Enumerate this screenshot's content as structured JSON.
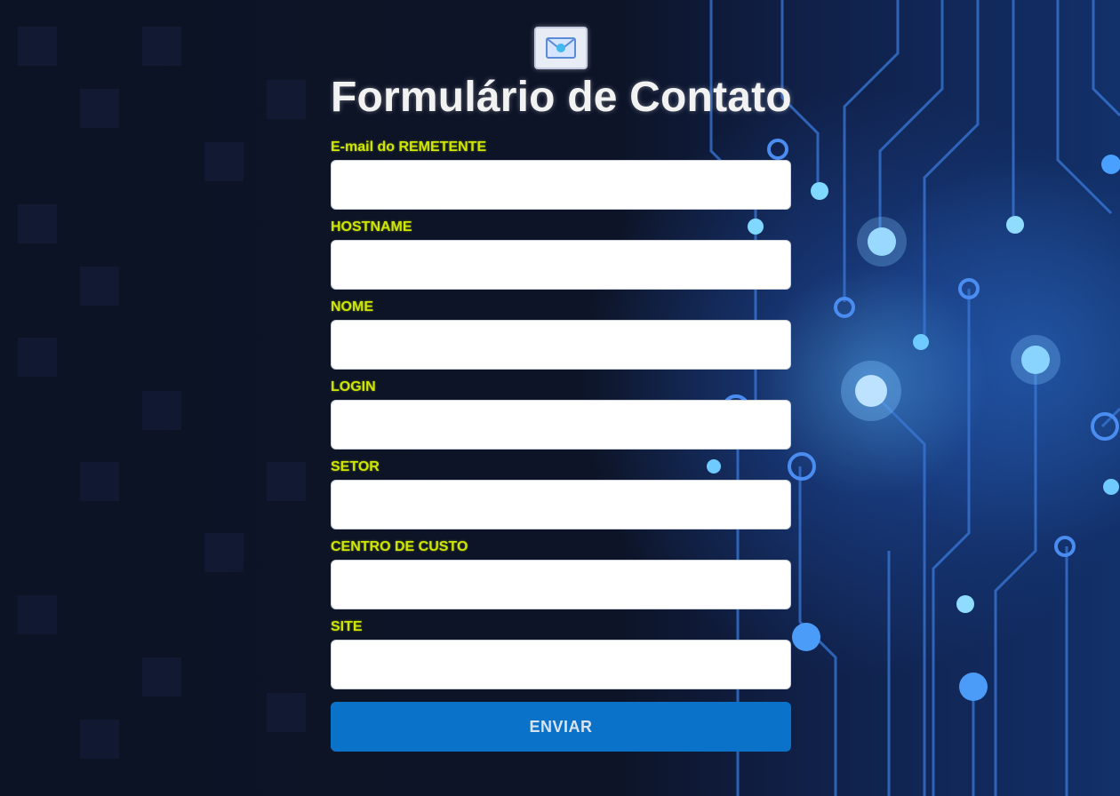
{
  "header": {
    "logo_icon": "envelope-logo-icon",
    "title": "Formulário de Contato"
  },
  "form": {
    "fields": [
      {
        "label": "E-mail do REMETENTE",
        "value": "",
        "placeholder": ""
      },
      {
        "label": "HOSTNAME",
        "value": "",
        "placeholder": ""
      },
      {
        "label": "NOME",
        "value": "",
        "placeholder": ""
      },
      {
        "label": "LOGIN",
        "value": "",
        "placeholder": ""
      },
      {
        "label": "SETOR",
        "value": "",
        "placeholder": ""
      },
      {
        "label": "CENTRO DE CUSTO",
        "value": "",
        "placeholder": ""
      },
      {
        "label": "SITE",
        "value": "",
        "placeholder": ""
      }
    ],
    "submit_label": "ENVIAR"
  },
  "colors": {
    "label": "#cfe600",
    "button": "#0a72c8",
    "title": "#f2f2f2",
    "background": "#0b1224"
  }
}
